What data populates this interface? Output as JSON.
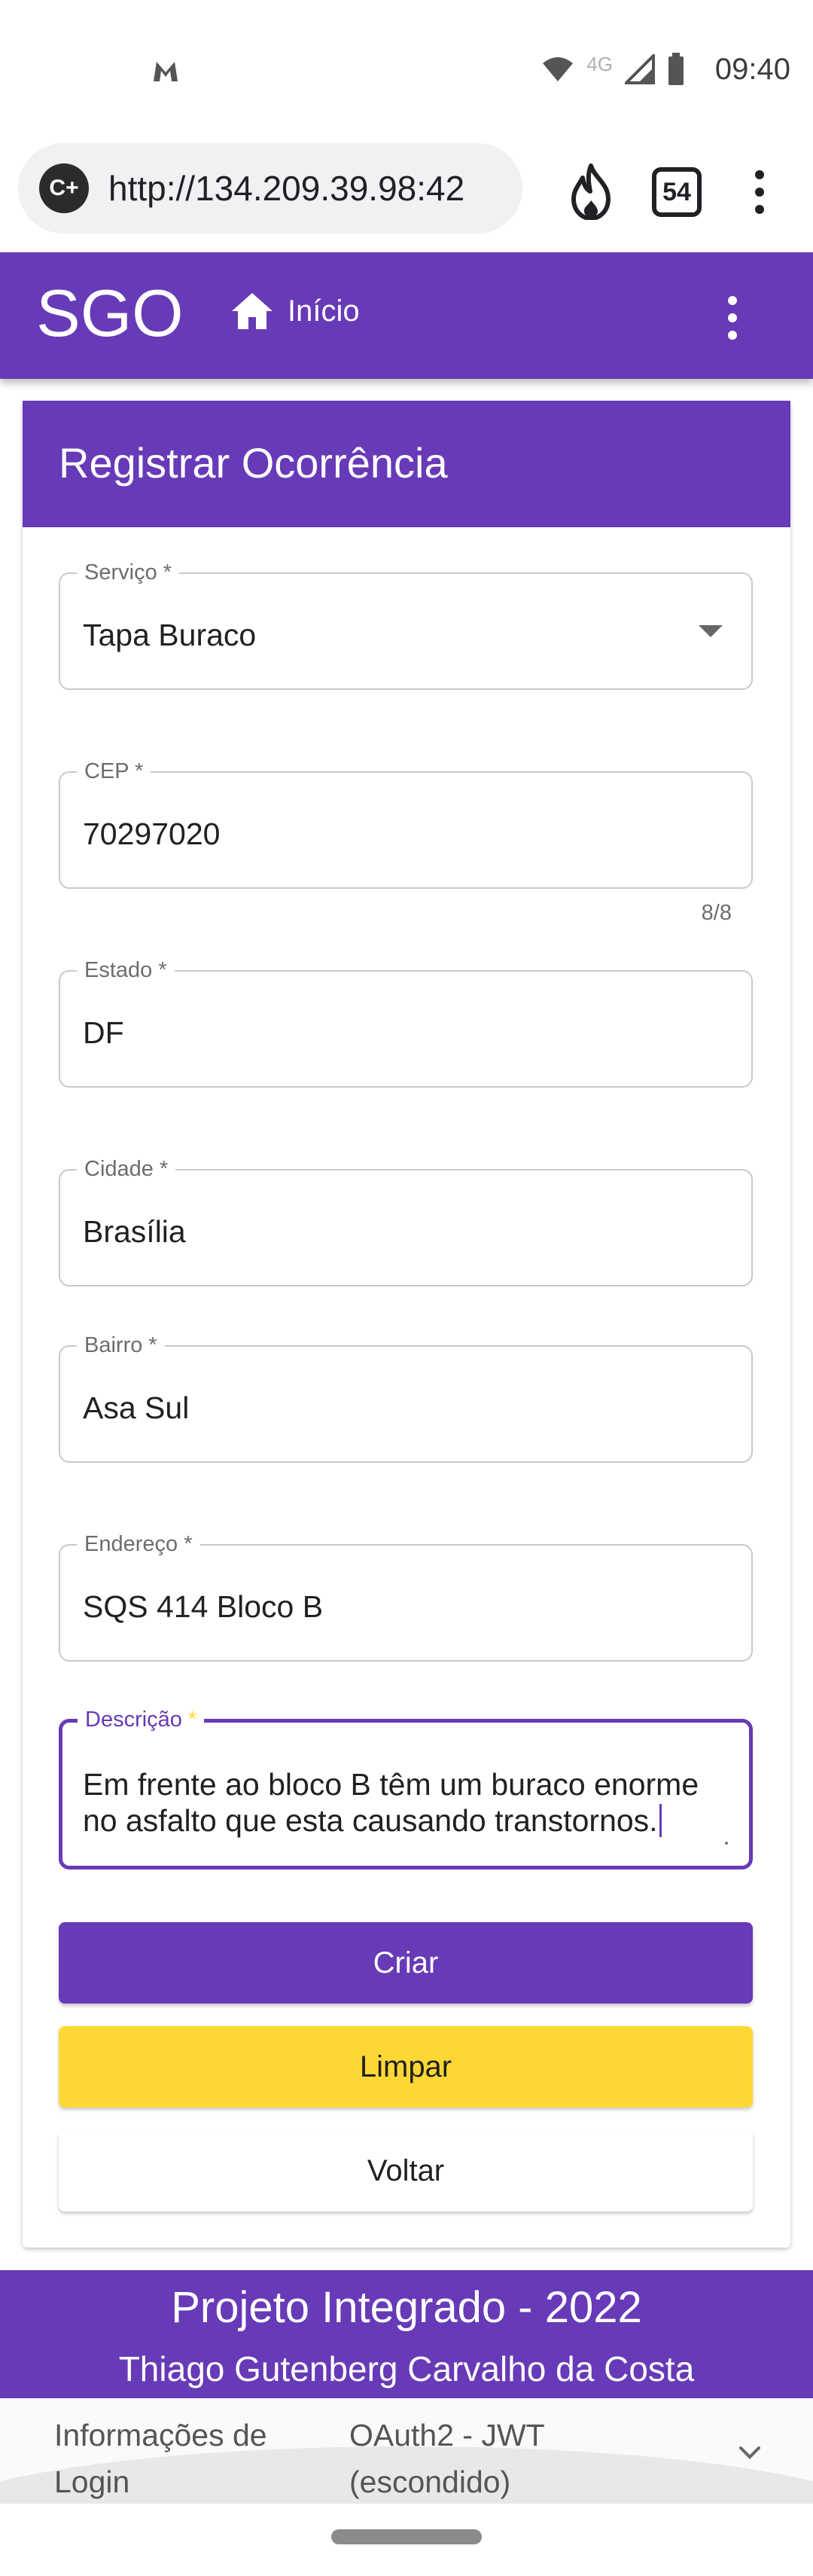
{
  "status_bar": {
    "time": "09:40",
    "network": "4G"
  },
  "browser": {
    "url": "http://134.209.39.98:42",
    "tab_count": "54",
    "site_icon_text": "C+"
  },
  "app_bar": {
    "title": "SGO",
    "home_label": "Início"
  },
  "form": {
    "title": "Registrar Ocorrência",
    "fields": {
      "servico": {
        "label": "Serviço *",
        "value": "Tapa Buraco"
      },
      "cep": {
        "label": "CEP *",
        "value": "70297020",
        "hint": "8/8"
      },
      "estado": {
        "label": "Estado *",
        "value": "DF"
      },
      "cidade": {
        "label": "Cidade *",
        "value": "Brasília"
      },
      "bairro": {
        "label": "Bairro *",
        "value": "Asa Sul"
      },
      "endereco": {
        "label": "Endereço *",
        "value": "SQS 414 Bloco B"
      },
      "descricao": {
        "label": "Descrição",
        "required_mark": "*",
        "value": "Em frente ao bloco B têm um buraco enorme no asfalto que esta causando transtornos."
      }
    },
    "buttons": {
      "create": "Criar",
      "clear": "Limpar",
      "back": "Voltar"
    }
  },
  "footer": {
    "line1": "Projeto Integrado - 2022",
    "line2": "Thiago Gutenberg Carvalho da Costa"
  },
  "info_panel": {
    "col1_line1": "Informações de",
    "col1_line2": "Login",
    "col2_line1": "OAuth2 - JWT",
    "col2_line2": "(escondido)"
  },
  "colors": {
    "primary": "#673ab7",
    "accent": "#fdd835",
    "white": "#ffffff"
  }
}
